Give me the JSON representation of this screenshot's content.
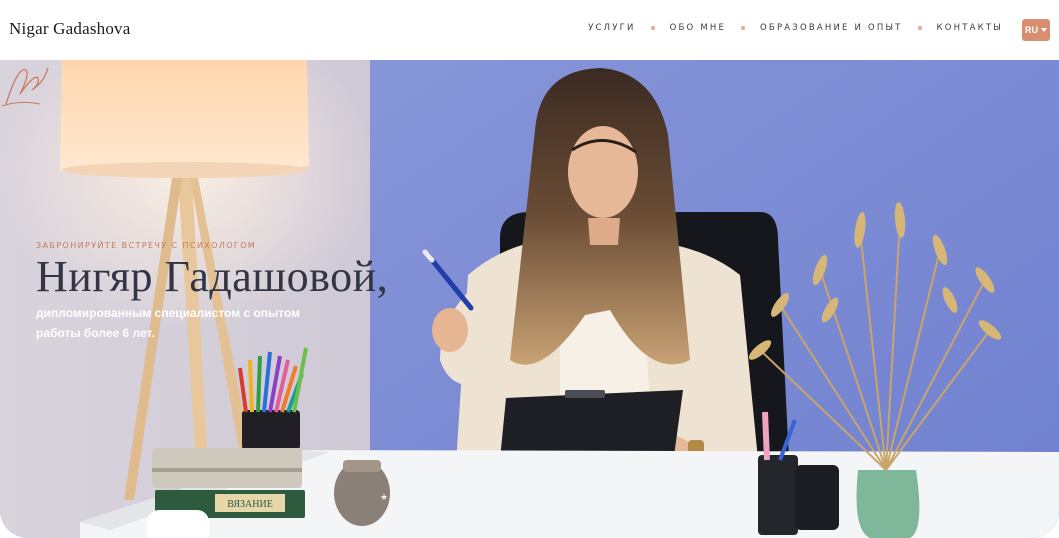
{
  "header": {
    "brand": "Nigar Gadashova",
    "nav": [
      {
        "label": "УСЛУГИ"
      },
      {
        "label": "ОБО МНЕ"
      },
      {
        "label": "ОБРАЗОВАНИЕ И ОПЫТ"
      },
      {
        "label": "КОНТАКТЫ"
      }
    ],
    "language": "RU"
  },
  "hero": {
    "eyebrow": "ЗАБРОНИРУЙТЕ ВСТРЕЧУ С ПСИХОЛОГОМ",
    "title": "Нигяр Гадашовой,",
    "subtitle": "дипломированным специалистом с опытом работы более 6 лет.",
    "book_spine": "ВЯЗАНИЕ"
  },
  "colors": {
    "accent": "#d98e6f",
    "nav_dot": "#e9a98d",
    "wall_blue": "#7e8fd6",
    "title_text": "#313545"
  },
  "icons": {
    "language_caret": "chevron-down-icon",
    "signature": "signature-icon"
  }
}
